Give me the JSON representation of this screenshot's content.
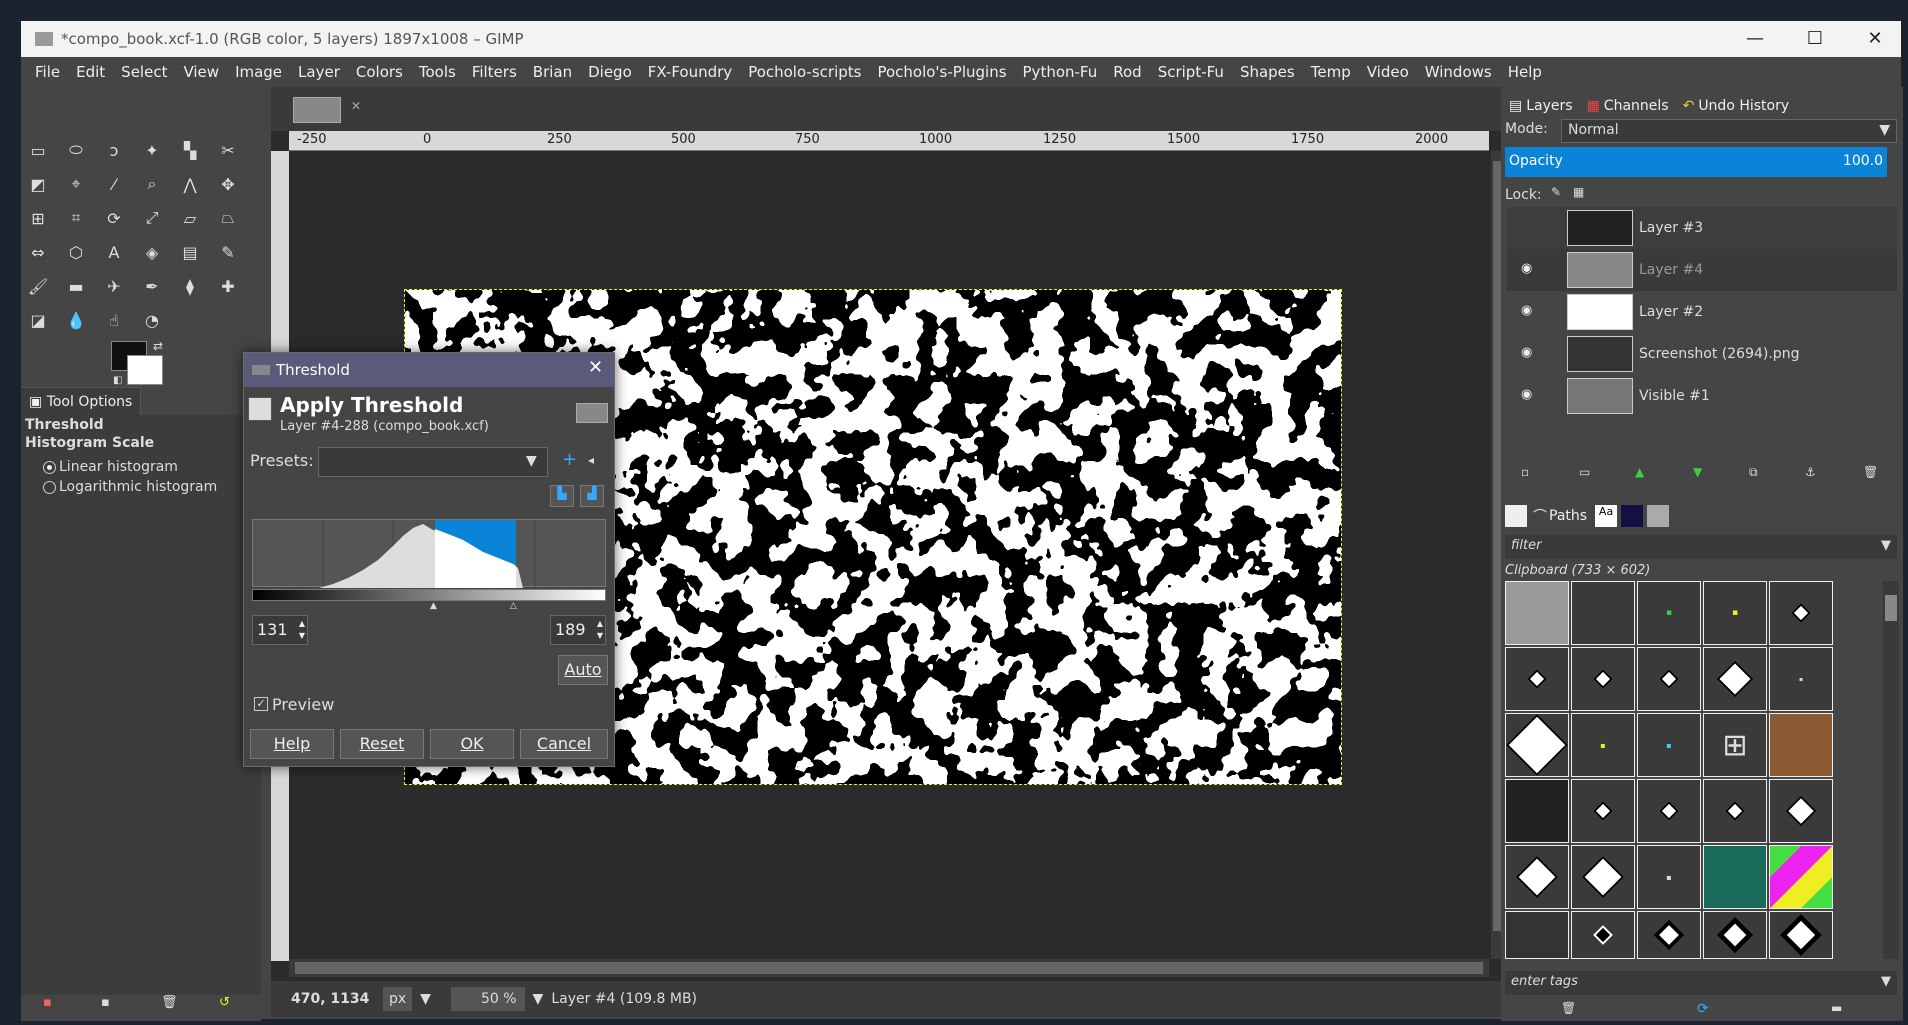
{
  "window": {
    "title": "*compo_book.xcf-1.0 (RGB color, 5 layers) 1897x1008 – GIMP",
    "minimize": "—",
    "maximize": "☐",
    "close": "✕"
  },
  "menu": [
    "File",
    "Edit",
    "Select",
    "View",
    "Image",
    "Layer",
    "Colors",
    "Tools",
    "Filters",
    "Brian",
    "Diego",
    "FX-Foundry",
    "Pocholo-scripts",
    "Pocholo's-Plugins",
    "Python-Fu",
    "Rod",
    "Script-Fu",
    "Shapes",
    "Temp",
    "Video",
    "Windows",
    "Help"
  ],
  "tool_options": {
    "tab_label": "Tool Options",
    "tool_name": "Threshold",
    "section": "Histogram Scale",
    "options": [
      "Linear histogram",
      "Logarithmic histogram"
    ],
    "selected": "Linear histogram"
  },
  "ruler": {
    "h_ticks": [
      "-250",
      "0",
      "250",
      "500",
      "750",
      "1000",
      "1250",
      "1500",
      "1750",
      "2000"
    ]
  },
  "status": {
    "coords": "470, 1134",
    "unit": "px",
    "zoom": "50 %",
    "layer_info": "Layer #4 (109.8 MB)"
  },
  "layers_panel": {
    "tabs": [
      "Layers",
      "Channels",
      "Undo History"
    ],
    "mode_label": "Mode:",
    "mode_value": "Normal",
    "opacity_label": "Opacity",
    "opacity_value": "100.0",
    "lock_label": "Lock:",
    "layers": [
      {
        "name": "Layer #3",
        "visible": false
      },
      {
        "name": "Layer #4",
        "visible": true
      },
      {
        "name": "Layer #2",
        "visible": true
      },
      {
        "name": "Screenshot (2694).png",
        "visible": true
      },
      {
        "name": "Visible #1",
        "visible": true
      }
    ]
  },
  "brushes_panel": {
    "tab_label": "Paths",
    "filter_placeholder": "filter",
    "clipboard_label": "Clipboard (733 × 602)",
    "tags_placeholder": "enter tags"
  },
  "threshold_dialog": {
    "title": "Threshold",
    "heading": "Apply Threshold",
    "subheading": "Layer #4-288 (compo_book.xcf)",
    "presets_label": "Presets:",
    "low": "131",
    "high": "189",
    "auto_label": "Auto",
    "preview_label": "Preview",
    "preview_checked": true,
    "buttons": {
      "help": "Help",
      "reset": "Reset",
      "ok": "OK",
      "cancel": "Cancel"
    }
  },
  "colors": {
    "accent": "#0a84d6",
    "selection": "#e8e820"
  }
}
